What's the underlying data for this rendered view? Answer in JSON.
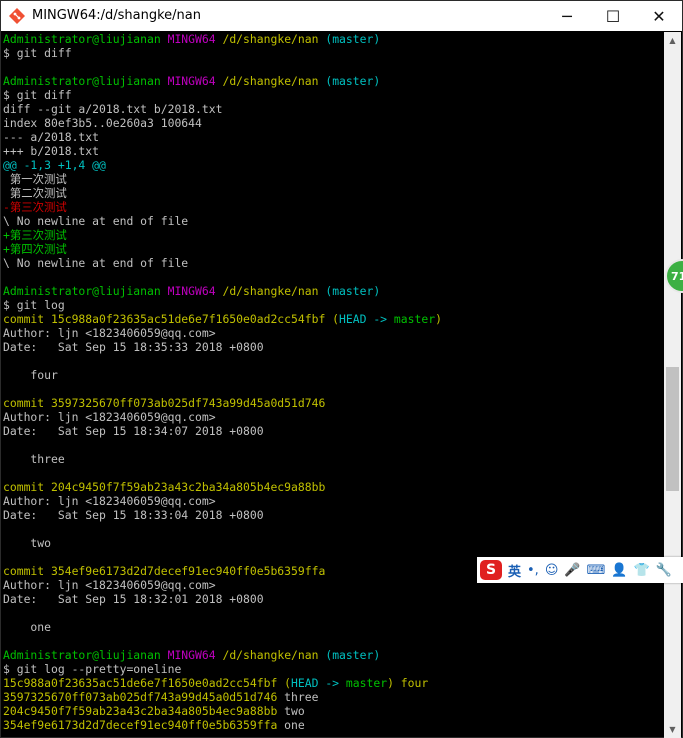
{
  "window": {
    "title": "MINGW64:/d/shangke/nan",
    "minimize_glyph": "─",
    "maximize_glyph": "☐",
    "close_glyph": "✕",
    "icon": "git-bash-icon"
  },
  "terminal": {
    "lines": [
      [
        {
          "t": "Administrator@liujianan ",
          "c": "g"
        },
        {
          "t": "MINGW64 ",
          "c": "m"
        },
        {
          "t": "/d/shangke/nan ",
          "c": "y"
        },
        {
          "t": "(master)",
          "c": "c"
        }
      ],
      [
        {
          "t": "$ git diff",
          "c": "w"
        }
      ],
      [
        {
          "t": "",
          "c": "w"
        }
      ],
      [
        {
          "t": "Administrator@liujianan ",
          "c": "g"
        },
        {
          "t": "MINGW64 ",
          "c": "m"
        },
        {
          "t": "/d/shangke/nan ",
          "c": "y"
        },
        {
          "t": "(master)",
          "c": "c"
        }
      ],
      [
        {
          "t": "$ git diff",
          "c": "w"
        }
      ],
      [
        {
          "t": "diff --git a/2018.txt b/2018.txt",
          "c": "w"
        }
      ],
      [
        {
          "t": "index 80ef3b5..0e260a3 100644",
          "c": "w"
        }
      ],
      [
        {
          "t": "--- a/2018.txt",
          "c": "w"
        }
      ],
      [
        {
          "t": "+++ b/2018.txt",
          "c": "w"
        }
      ],
      [
        {
          "t": "@@ -1,3 +1,4 @@",
          "c": "c"
        }
      ],
      [
        {
          "t": " 第一次测试",
          "c": "w"
        }
      ],
      [
        {
          "t": " 第二次测试",
          "c": "w"
        }
      ],
      [
        {
          "t": "-第三次测试",
          "c": "r"
        }
      ],
      [
        {
          "t": "\\ No newline at end of file",
          "c": "w"
        }
      ],
      [
        {
          "t": "+第三次测试",
          "c": "g"
        }
      ],
      [
        {
          "t": "+第四次测试",
          "c": "g"
        }
      ],
      [
        {
          "t": "\\ No newline at end of file",
          "c": "w"
        }
      ],
      [
        {
          "t": "",
          "c": "w"
        }
      ],
      [
        {
          "t": "Administrator@liujianan ",
          "c": "g"
        },
        {
          "t": "MINGW64 ",
          "c": "m"
        },
        {
          "t": "/d/shangke/nan ",
          "c": "y"
        },
        {
          "t": "(master)",
          "c": "c"
        }
      ],
      [
        {
          "t": "$ git log",
          "c": "w"
        }
      ],
      [
        {
          "t": "commit 15c988a0f23635ac51de6e7f1650e0ad2cc54fbf ",
          "c": "y"
        },
        {
          "t": "(",
          "c": "y"
        },
        {
          "t": "HEAD -> ",
          "c": "c"
        },
        {
          "t": "master",
          "c": "g"
        },
        {
          "t": ")",
          "c": "y"
        }
      ],
      [
        {
          "t": "Author: ljn <1823406059@qq.com>",
          "c": "w"
        }
      ],
      [
        {
          "t": "Date:   Sat Sep 15 18:35:33 2018 +0800",
          "c": "w"
        }
      ],
      [
        {
          "t": "",
          "c": "w"
        }
      ],
      [
        {
          "t": "    four",
          "c": "w"
        }
      ],
      [
        {
          "t": "",
          "c": "w"
        }
      ],
      [
        {
          "t": "commit 3597325670ff073ab025df743a99d45a0d51d746",
          "c": "y"
        }
      ],
      [
        {
          "t": "Author: ljn <1823406059@qq.com>",
          "c": "w"
        }
      ],
      [
        {
          "t": "Date:   Sat Sep 15 18:34:07 2018 +0800",
          "c": "w"
        }
      ],
      [
        {
          "t": "",
          "c": "w"
        }
      ],
      [
        {
          "t": "    three",
          "c": "w"
        }
      ],
      [
        {
          "t": "",
          "c": "w"
        }
      ],
      [
        {
          "t": "commit 204c9450f7f59ab23a43c2ba34a805b4ec9a88bb",
          "c": "y"
        }
      ],
      [
        {
          "t": "Author: ljn <1823406059@qq.com>",
          "c": "w"
        }
      ],
      [
        {
          "t": "Date:   Sat Sep 15 18:33:04 2018 +0800",
          "c": "w"
        }
      ],
      [
        {
          "t": "",
          "c": "w"
        }
      ],
      [
        {
          "t": "    two",
          "c": "w"
        }
      ],
      [
        {
          "t": "",
          "c": "w"
        }
      ],
      [
        {
          "t": "commit 354ef9e6173d2d7decef91ec940ff0e5b6359ffa",
          "c": "y"
        }
      ],
      [
        {
          "t": "Author: ljn <1823406059@qq.com>",
          "c": "w"
        }
      ],
      [
        {
          "t": "Date:   Sat Sep 15 18:32:01 2018 +0800",
          "c": "w"
        }
      ],
      [
        {
          "t": "",
          "c": "w"
        }
      ],
      [
        {
          "t": "    one",
          "c": "w"
        }
      ],
      [
        {
          "t": "",
          "c": "w"
        }
      ],
      [
        {
          "t": "Administrator@liujianan ",
          "c": "g"
        },
        {
          "t": "MINGW64 ",
          "c": "m"
        },
        {
          "t": "/d/shangke/nan ",
          "c": "y"
        },
        {
          "t": "(master)",
          "c": "c"
        }
      ],
      [
        {
          "t": "$ git log --pretty=oneline",
          "c": "w"
        }
      ],
      [
        {
          "t": "15c988a0f23635ac51de6e7f1650e0ad2cc54fbf ",
          "c": "y"
        },
        {
          "t": "(",
          "c": "y"
        },
        {
          "t": "HEAD -> ",
          "c": "c"
        },
        {
          "t": "master",
          "c": "g"
        },
        {
          "t": ") four",
          "c": "y"
        }
      ],
      [
        {
          "t": "3597325670ff073ab025df743a99d45a0d51d746 ",
          "c": "y"
        },
        {
          "t": "three",
          "c": "w"
        }
      ],
      [
        {
          "t": "204c9450f7f59ab23a43c2ba34a805b4ec9a88bb ",
          "c": "y"
        },
        {
          "t": "two",
          "c": "w"
        }
      ],
      [
        {
          "t": "354ef9e6173d2d7decef91ec940ff0e5b6359ffa ",
          "c": "y"
        },
        {
          "t": "one",
          "c": "w"
        }
      ]
    ]
  },
  "float_badge": {
    "text": "71",
    "color": "#3cb043"
  },
  "ime_toolbar": {
    "logo": "S",
    "language": "英",
    "punctuation_glyph": "•,",
    "emoji_glyph": "☺",
    "voice_glyph": "🎤",
    "keyboard_glyph": "⌨",
    "user_glyph": "👤",
    "skin_glyph": "👕",
    "tools_glyph": "🔧"
  },
  "scrollbar": {
    "position_fraction": 0.58,
    "up_glyph": "▲",
    "down_glyph": "▼"
  },
  "colors": {
    "green": "#00c000",
    "magenta": "#bf00bf",
    "yellow": "#c0c000",
    "cyan": "#00c0c0",
    "red": "#d00000",
    "text": "#c0c0c0",
    "background": "#000000"
  }
}
